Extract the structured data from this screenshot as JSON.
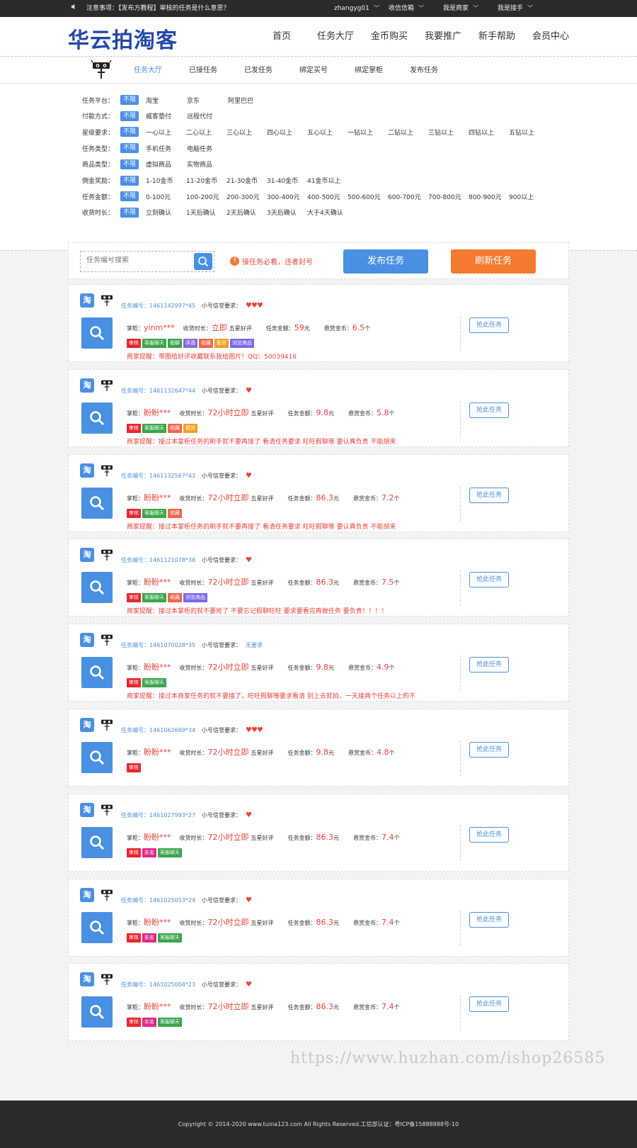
{
  "topbar": {
    "notice": "注意事项：【发布方教程】审核的任务是什么意思？",
    "user": "zhangyg01",
    "inbox": "收信信箱",
    "buyer": "我是商家",
    "worker": "我是接手"
  },
  "header": {
    "logo": "华云拍淘客",
    "nav": [
      "首页",
      "任务大厅",
      "金币购买",
      "我要推广",
      "新手帮助",
      "会员中心"
    ]
  },
  "subnav": {
    "tabs": [
      "任务大厅",
      "已接任务",
      "已发任务",
      "绑定买号",
      "绑定掌柜",
      "发布任务"
    ],
    "active": 0
  },
  "filters": [
    {
      "label": "任务平台：",
      "selected": "不限",
      "options": [
        "淘宝",
        "京东",
        "阿里巴巴"
      ]
    },
    {
      "label": "付款方式：",
      "selected": "不限",
      "options": [
        "威客垫付",
        "远程代付"
      ]
    },
    {
      "label": "星级要求：",
      "selected": "不限",
      "options": [
        "一心以上",
        "二心以上",
        "三心以上",
        "四心以上",
        "五心以上",
        "一钻以上",
        "二钻以上",
        "三钻以上",
        "四钻以上",
        "五钻以上"
      ]
    },
    {
      "label": "任务类型：",
      "selected": "不限",
      "options": [
        "手机任务",
        "电脑任务"
      ]
    },
    {
      "label": "商品类型：",
      "selected": "不限",
      "options": [
        "虚拟商品",
        "实物商品"
      ]
    },
    {
      "label": "佣金奖励：",
      "selected": "不限",
      "options": [
        "1-10金币",
        "11-20金币",
        "21-30金币",
        "31-40金币",
        "41金币以上"
      ]
    },
    {
      "label": "任务金额：",
      "selected": "不限",
      "options": [
        "0-100元",
        "100-200元",
        "200-300元",
        "300-400元",
        "400-500元",
        "500-600元",
        "600-700元",
        "700-800元",
        "800-900元",
        "900以上"
      ]
    },
    {
      "label": "收货时长：",
      "selected": "不限",
      "options": [
        "立刻确认",
        "1天后确认",
        "2天后确认",
        "3天后确认",
        "大于4天确认"
      ]
    }
  ],
  "search": {
    "placeholder": "任务编号搜索",
    "tip": "接任务必看，违者封号",
    "publish": "发布任务",
    "refresh": "刷新任务"
  },
  "labels": {
    "no": "任务编号：",
    "req": "小号信誉要求：",
    "seller": "掌柜：",
    "time": "收货时长：",
    "review": "五星好评",
    "amount": "任务金额：",
    "reward": "悬赏金币：",
    "yuan": "元",
    "ge": "个",
    "grab": "抢此任务",
    "noreq": "无要求"
  },
  "tag_colors": {
    "审核": "#e8272f",
    "客服聊天": "#3aa54a",
    "假聊": "#3aa54a",
    "评语": "#8a6be0",
    "收藏": "#f0664a",
    "假货": "#f0a020",
    "浏览商品": "#7b68ee",
    "实名": "#e0288a"
  },
  "tasks": [
    {
      "no": "1461142997*45",
      "hearts": "♥♥♥",
      "seller": "yinm***",
      "time": "立即",
      "amount": "59",
      "reward": "6.5",
      "tags": [
        "审核",
        "客服聊天",
        "假聊",
        "评语",
        "收藏",
        "假货",
        "浏览商品"
      ],
      "remark": "商家提醒：带图给好评收藏联系我给图片！QQ：50039416"
    },
    {
      "no": "1461132647*44",
      "hearts": "♥",
      "seller": "盼盼***",
      "time": "72小时立即",
      "amount": "9.8",
      "reward": "5.8",
      "tags": [
        "审核",
        "客服聊天",
        "收藏",
        "假货"
      ],
      "remark": "商家提醒：接过本掌柜任务的刷手就不要再接了 看清任务要求 旺旺假聊等 要认真负责 不能胡来"
    },
    {
      "no": "1461132567*43",
      "hearts": "♥",
      "seller": "盼盼***",
      "time": "72小时立即",
      "amount": "86.3",
      "reward": "7.2",
      "tags": [
        "审核",
        "客服聊天",
        "收藏"
      ],
      "remark": "商家提醒：接过本掌柜任务的刷手就不要再接了 看清任务要求 旺旺假聊等 要认真负责 不能胡来"
    },
    {
      "no": "1461121078*38",
      "hearts": "♥",
      "seller": "盼盼***",
      "time": "72小时立即",
      "amount": "86.3",
      "reward": "7.5",
      "tags": [
        "审核",
        "客服聊天",
        "收藏",
        "浏览商品"
      ],
      "remark": "商家提醒：接过本掌柜的就不要抢了 不要忘记假聊旺旺 要求要看完再做任务 要负责！！！！"
    },
    {
      "no": "1461070028*35",
      "hearts": "",
      "seller": "盼盼***",
      "time": "72小时立即",
      "amount": "9.8",
      "reward": "4.9",
      "tags": [
        "审核",
        "客服聊天"
      ],
      "remark": "商家提醒：接过本商家任务的就不要接了，旺旺假聊等要求看清 别上去就拍，一天接两个任务以上的不"
    },
    {
      "no": "1461062669*34",
      "hearts": "♥♥♥",
      "seller": "盼盼***",
      "time": "72小时立即",
      "amount": "9.8",
      "reward": "4.8",
      "tags": [
        "审核"
      ],
      "remark": ""
    },
    {
      "no": "1461027993*27",
      "hearts": "♥",
      "seller": "盼盼***",
      "time": "72小时立即",
      "amount": "86.3",
      "reward": "7.4",
      "tags": [
        "审核",
        "实名",
        "客服聊天"
      ],
      "remark": ""
    },
    {
      "no": "1461025053*24",
      "hearts": "♥",
      "seller": "盼盼***",
      "time": "72小时立即",
      "amount": "86.3",
      "reward": "7.4",
      "tags": [
        "审核",
        "实名",
        "客服聊天"
      ],
      "remark": ""
    },
    {
      "no": "1461025004*23",
      "hearts": "♥",
      "seller": "盼盼***",
      "time": "72小时立即",
      "amount": "86.3",
      "reward": "7.4",
      "tags": [
        "审核",
        "实名",
        "客服聊天"
      ],
      "remark": ""
    }
  ],
  "watermark": "https://www.huzhan.com/ishop26585",
  "footer": "Copyright © 2014-2020 www.tuina123.com All Rights Reserved.工信部认证：粤ICP备15888888号-10"
}
